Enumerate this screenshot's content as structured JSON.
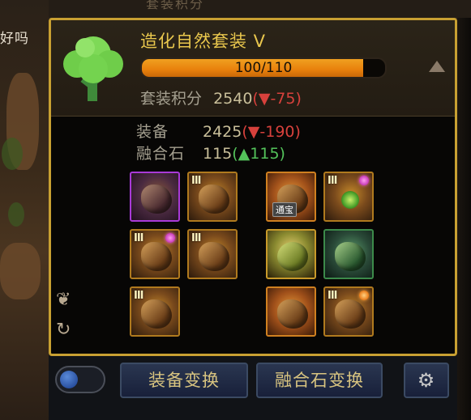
{
  "background": {
    "side_text": "好吗"
  },
  "top_strip": {
    "text": "套装积分"
  },
  "set": {
    "name": "造化自然套装 V",
    "progress_text": "100/110",
    "progress_fraction": 0.909,
    "score_label": "套装积分",
    "score_value": "2540",
    "score_change": "(▼-75)"
  },
  "stats": {
    "equipment_label": "装备",
    "equipment_value": "2425",
    "equipment_change": "(▼-190)",
    "fusion_label": "融合石",
    "fusion_value": "115",
    "fusion_change": "(▲115)"
  },
  "slots": {
    "tradeable_tag": "通宝",
    "tier_mark": "III"
  },
  "bottom": {
    "equip_swap_label": "装备变换",
    "fusion_swap_label": "融合石变换",
    "settings_icon": "wrench-gear-icon"
  },
  "colors": {
    "border_gold": "#c8a032",
    "set_name": "#e9c74d",
    "decrease": "#d7413c",
    "increase": "#53c25a",
    "progress": "#e8800c"
  }
}
